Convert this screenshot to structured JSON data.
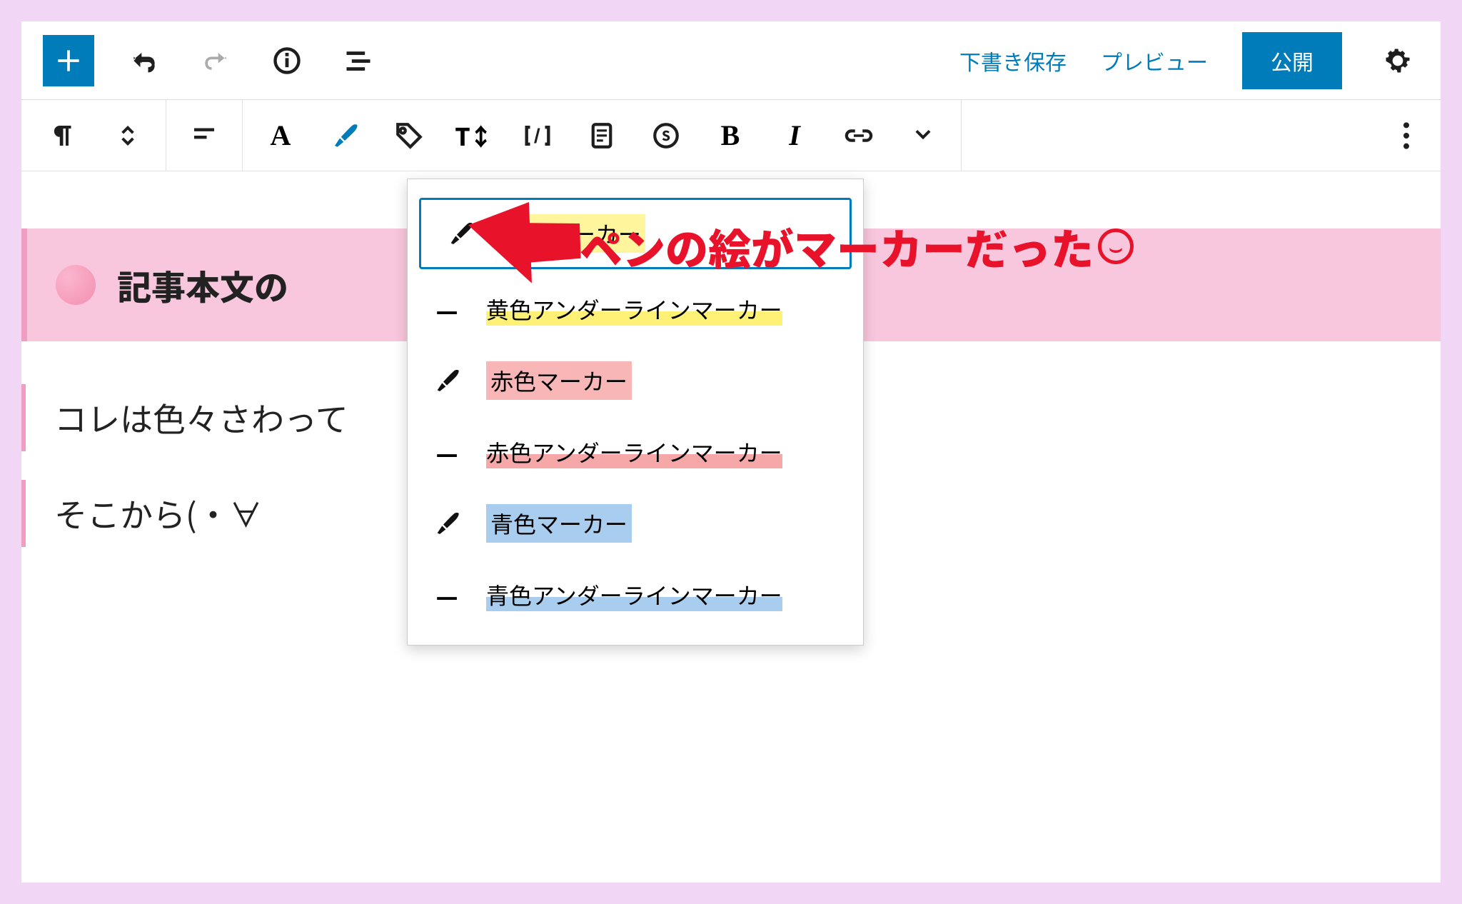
{
  "topbar": {
    "save_draft": "下書き保存",
    "preview": "プレビュー",
    "publish": "公開"
  },
  "content": {
    "heading": "記事本文の",
    "para1": "コレは色々さわって",
    "para2": "そこから(・∀"
  },
  "dropdown": {
    "items": [
      {
        "label": "黄色マーカー",
        "style": "highlight",
        "color": "y",
        "selected": true
      },
      {
        "label": "黄色アンダーラインマーカー",
        "style": "underline",
        "color": "y",
        "selected": false
      },
      {
        "label": "赤色マーカー",
        "style": "highlight",
        "color": "r",
        "selected": false
      },
      {
        "label": "赤色アンダーラインマーカー",
        "style": "underline",
        "color": "r",
        "selected": false
      },
      {
        "label": "青色マーカー",
        "style": "highlight",
        "color": "b",
        "selected": false
      },
      {
        "label": "青色アンダーラインマーカー",
        "style": "underline",
        "color": "b",
        "selected": false
      }
    ]
  },
  "annotation": {
    "text": "ペンの絵がマーカーだった"
  },
  "colors": {
    "primary": "#007cba",
    "annotation_red": "#e8122a",
    "heading_pink": "#f9c7dd"
  }
}
